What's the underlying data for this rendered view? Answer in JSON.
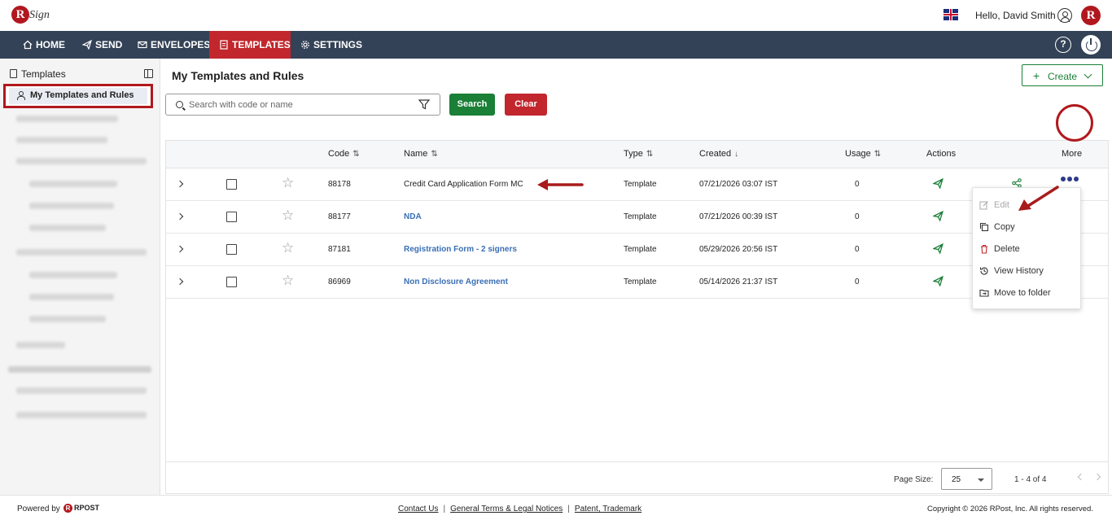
{
  "header": {
    "logo_text": "Sign",
    "greeting": "Hello, David Smith",
    "avatar_letter": "R"
  },
  "nav": {
    "items": [
      {
        "label": "HOME",
        "icon": "home-icon"
      },
      {
        "label": "SEND",
        "icon": "send-icon"
      },
      {
        "label": "ENVELOPES",
        "icon": "envelope-icon"
      },
      {
        "label": "TEMPLATES",
        "icon": "template-icon",
        "active": true
      },
      {
        "label": "SETTINGS",
        "icon": "gear-icon"
      }
    ],
    "help": "?"
  },
  "sidebar": {
    "title": "Templates",
    "active_item": "My Templates and Rules"
  },
  "main": {
    "title": "My Templates and Rules",
    "create_label": "Create",
    "search_placeholder": "Search with code or name",
    "search_button": "Search",
    "clear_button": "Clear"
  },
  "table": {
    "columns": [
      "Code",
      "Name",
      "Type",
      "Created",
      "Usage",
      "Actions",
      "More"
    ],
    "rows": [
      {
        "code": "88178",
        "name": "Credit Card Application Form MC",
        "type": "Template",
        "created": "07/21/2026 03:07 IST",
        "usage": "0"
      },
      {
        "code": "88177",
        "name": "NDA",
        "type": "Template",
        "created": "07/21/2026 00:39 IST",
        "usage": "0"
      },
      {
        "code": "87181",
        "name": "Registration Form - 2 signers",
        "type": "Template",
        "created": "05/29/2026 20:56 IST",
        "usage": "0"
      },
      {
        "code": "86969",
        "name": "Non Disclosure Agreement",
        "type": "Template",
        "created": "05/14/2026 21:37 IST",
        "usage": "0"
      }
    ]
  },
  "more_menu": {
    "items": [
      {
        "label": "Edit",
        "icon": "edit-icon",
        "disabled": true
      },
      {
        "label": "Copy",
        "icon": "copy-icon"
      },
      {
        "label": "Delete",
        "icon": "trash-icon"
      },
      {
        "label": "View History",
        "icon": "history-icon"
      },
      {
        "label": "Move to folder",
        "icon": "folder-icon"
      }
    ]
  },
  "pagination": {
    "page_size_label": "Page Size:",
    "page_size": "25",
    "range": "1 - 4 of 4"
  },
  "footer": {
    "powered_by": "Powered by",
    "brand": "RPOST",
    "links": [
      "Contact Us",
      "General Terms & Legal Notices",
      "Patent, Trademark"
    ],
    "copyright": "Copyright © 2026 RPost, Inc. All rights reserved."
  },
  "colors": {
    "nav_bg": "#334256",
    "accent_red": "#c1272d",
    "brand_red": "#b1181e",
    "success_green": "#1a7f37",
    "link_blue": "#3a6fb5"
  }
}
